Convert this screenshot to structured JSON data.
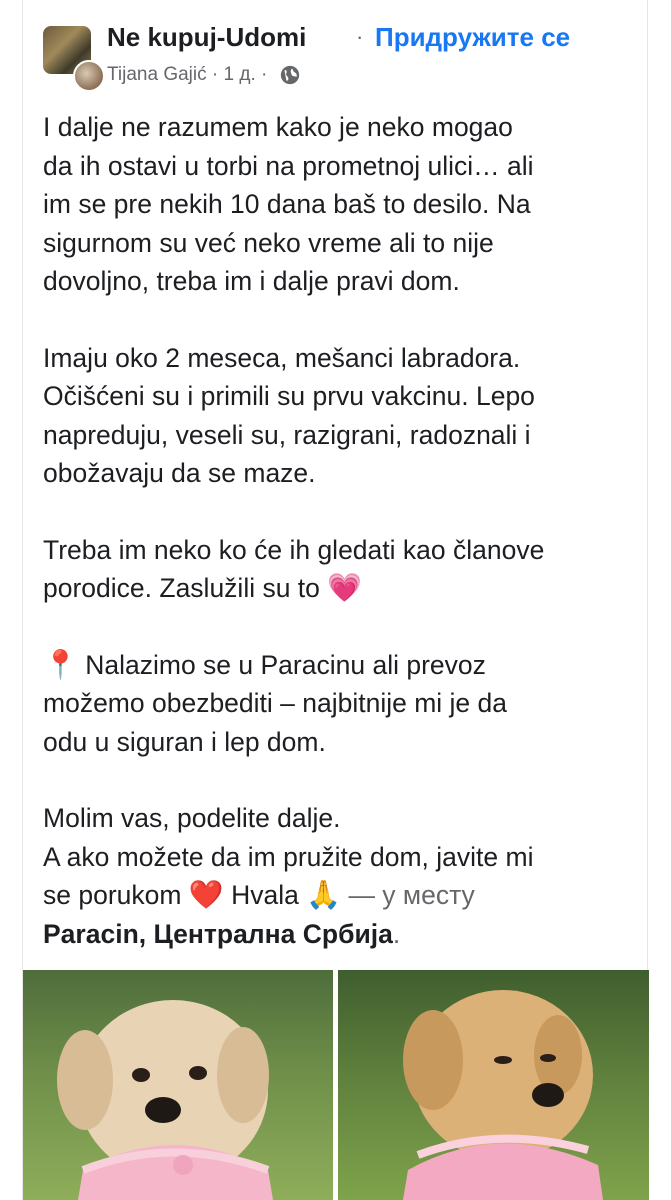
{
  "post": {
    "group_name": "Ne kupuj-Udomi",
    "separator": "·",
    "join_label": "Придружите се",
    "author": "Tijana Gajić",
    "time": "1 д.",
    "privacy_icon": "globe-icon"
  },
  "body": {
    "p1": [
      "I dalje ne razumem kako je neko mogao",
      "da ih ostavi u torbi na prometnoj ulici… ali",
      "im se pre nekih 10 dana baš to desilo. Na",
      "sigurnom su već neko vreme ali to nije",
      "dovoljno, treba im i dalje pravi dom."
    ],
    "p2": [
      "Imaju oko 2 meseca, mešanci labradora.",
      "Očišćeni su i primili su prvu vakcinu. Lepo",
      "napreduju, veseli su, razigrani, radoznali i",
      "obožavaju da se maze."
    ],
    "p3": {
      "line1": "Treba im neko ko će ih gledati kao članove",
      "line2": "porodice. Zaslužili su to",
      "emoji_heart": "💗"
    },
    "p4": {
      "emoji_pin": "📍",
      "line1": " Nalazimo se u Paracinu ali prevoz",
      "line2": "možemo obezbediti – najbitnije mi je da",
      "line3": "odu u siguran i lep dom."
    },
    "p5": {
      "line1": "Molim vas, podelite dalje.",
      "line2": "A ako možete da im pružite dom, javite mi",
      "line3_a": "se porukom",
      "emoji_heart": "❤️",
      "line3_b": " Hvala",
      "emoji_pray": "🙏",
      "location_prefix": " — у месту",
      "location": "Paracin, Централна Србија",
      "location_period": "."
    }
  }
}
